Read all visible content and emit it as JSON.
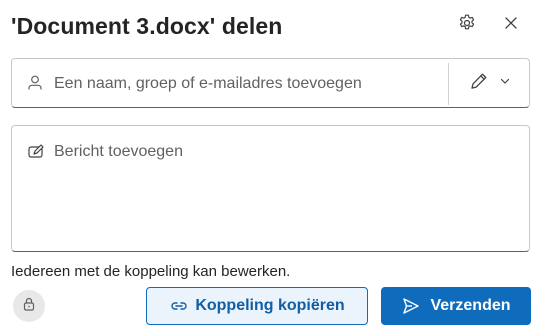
{
  "dialog": {
    "title": "'Document 3.docx' delen",
    "settings_icon": "gear-icon",
    "close_icon": "close-icon"
  },
  "recipients": {
    "icon": "person-icon",
    "placeholder": "Een naam, groep of e-mailadres toevoegen",
    "value": "",
    "permission_icon": "pencil-icon",
    "permission_dropdown_icon": "chevron-down-icon"
  },
  "message": {
    "icon": "compose-icon",
    "placeholder": "Bericht toevoegen",
    "value": ""
  },
  "link_settings": {
    "text": "Iedereen met de koppeling kan bewerken.",
    "lock_icon": "lock-icon"
  },
  "actions": {
    "copy_link_label": "Koppeling kopiëren",
    "copy_link_icon": "link-icon",
    "send_label": "Verzenden",
    "send_icon": "send-icon"
  },
  "colors": {
    "primary": "#0f6cbd",
    "primary_light_bg": "#ebf3fc",
    "text": "#242424",
    "placeholder": "#616161",
    "border": "#c8c8c8",
    "lock_bg": "#e8e8e8"
  }
}
